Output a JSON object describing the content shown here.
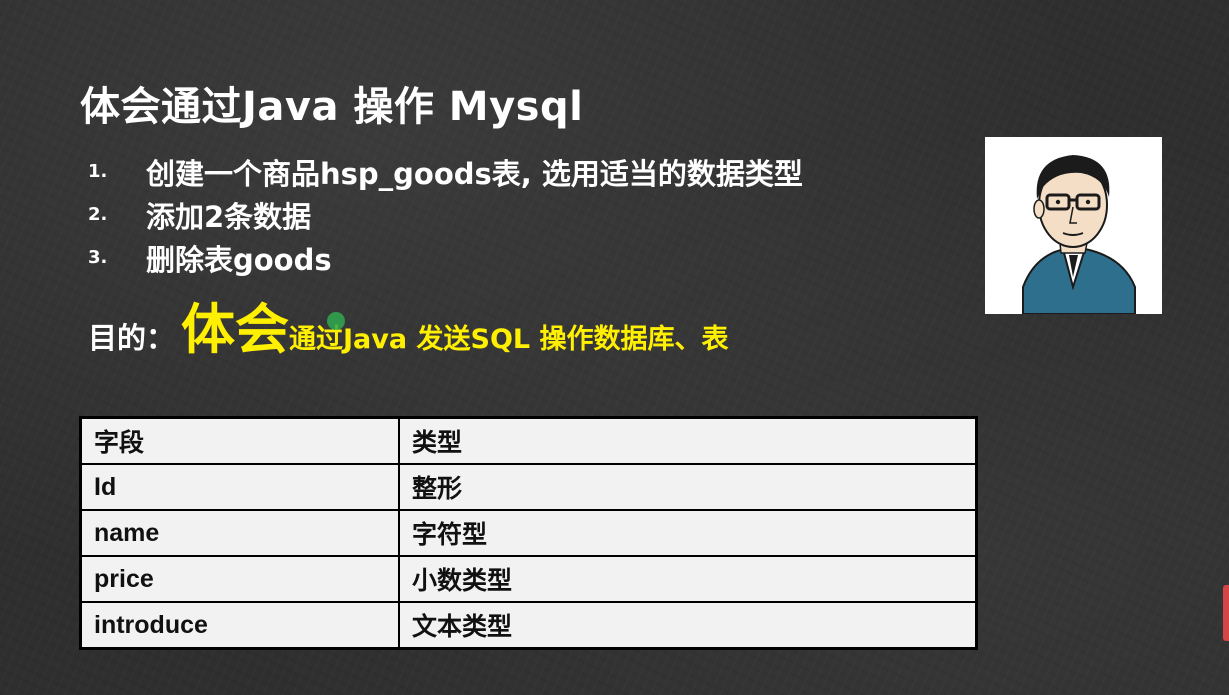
{
  "slide": {
    "title": "体会通过Java 操作 Mysql",
    "tasks": [
      {
        "num": "1.",
        "text": "创建一个商品hsp_goods表, 选用适当的数据类型"
      },
      {
        "num": "2.",
        "text": "添加2条数据"
      },
      {
        "num": "3.",
        "text": "删除表goods"
      }
    ],
    "purpose": {
      "label": "目的：",
      "emphasis": "体会",
      "rest": "通过Java 发送SQL 操作数据库、表"
    },
    "table": {
      "headers": [
        "字段",
        "类型"
      ],
      "rows": [
        [
          "Id",
          "整形"
        ],
        [
          "name",
          "字符型"
        ],
        [
          "price",
          "小数类型"
        ],
        [
          "introduce",
          "文本类型"
        ]
      ]
    }
  },
  "colors": {
    "background": "#2f2f2f",
    "title_text": "#ffffff",
    "purpose_highlight": "#ffef00",
    "table_background": "#f2f2f2",
    "table_border": "#000000"
  },
  "icons": {
    "avatar": "presenter-portrait-illustration",
    "cursor": "green-cursor-dot"
  }
}
